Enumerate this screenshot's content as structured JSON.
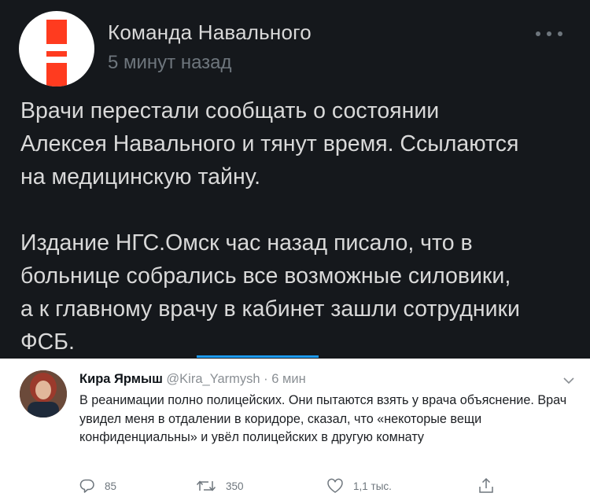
{
  "post": {
    "author": "Команда Навального",
    "time": "5 минут назад",
    "text": "Врачи перестали сообщать о состоянии\nАлексея Навального и тянут время. Ссылаются\nна медицинскую тайну.\n\nИздание НГС.Омск час назад писало, что в\nбольнице собрались все возможные силовики,\nа к главному врачу в кабинет зашли сотрудники\nФСБ.",
    "logo_color": "#ff3b1f",
    "background": "#15181c"
  },
  "tweet": {
    "name": "Кира Ярмыш",
    "handle": "@Kira_Yarmysh",
    "dot": "·",
    "time": "6 мин",
    "text": "В реанимации полно полицейских. Они пытаются взять у врача объяснение. Врач увидел меня в отдалении в коридоре, сказал, что «некоторые вещи конфиденциальны» и увёл полицейских в другую комнату",
    "replies": "85",
    "retweets": "350",
    "likes": "1,1 тыс.",
    "icons": [
      "reply-icon",
      "retweet-icon",
      "like-icon",
      "share-icon"
    ],
    "accent": "#1d9bf0"
  }
}
